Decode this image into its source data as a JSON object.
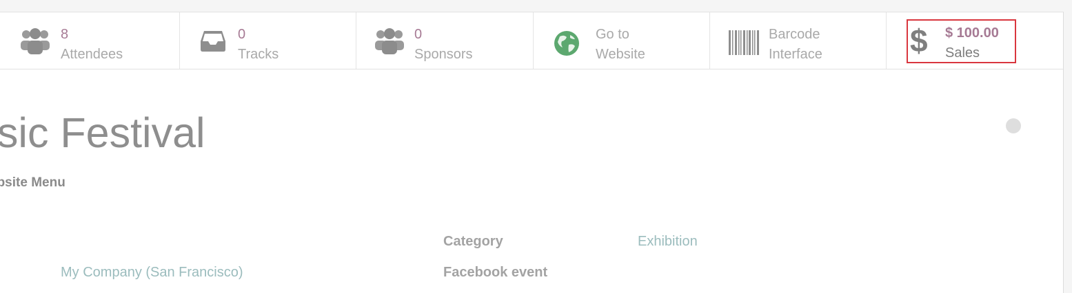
{
  "stat_buttons": {
    "attendees": {
      "value": "8",
      "label": "Attendees",
      "icon": "users-icon"
    },
    "tracks": {
      "value": "0",
      "label": "Tracks",
      "icon": "inbox-icon"
    },
    "sponsors": {
      "value": "0",
      "label": "Sponsors",
      "icon": "users-icon"
    },
    "website": {
      "line1": "Go to",
      "line2": "Website",
      "icon": "globe-icon"
    },
    "barcode": {
      "line1": "Barcode",
      "line2": "Interface",
      "icon": "barcode-icon"
    },
    "sales": {
      "value": "$ 100.00",
      "label": "Sales",
      "icon": "dollar-icon",
      "symbol": "$"
    }
  },
  "record": {
    "title": "usic Festival",
    "subtitle": "ebsite Menu"
  },
  "fields": {
    "category_label": "Category",
    "category_value": "Exhibition",
    "facebook_label": "Facebook event",
    "company_value": "My Company (San Francisco)"
  },
  "colors": {
    "accent": "#a67a94",
    "link": "#9bbcbd",
    "highlight_border": "#d9363e",
    "globe": "#5ca86f"
  }
}
